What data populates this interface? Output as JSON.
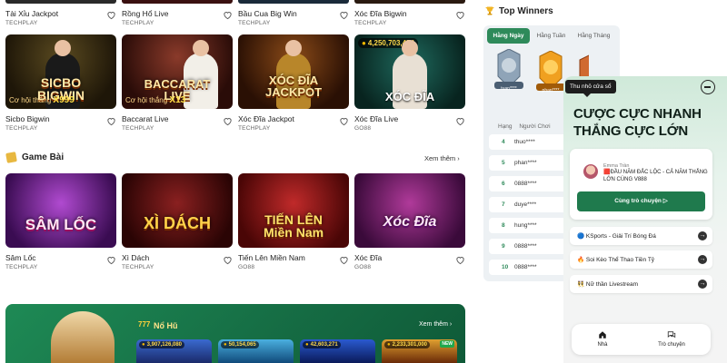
{
  "top_row": [
    {
      "name": "Tài Xỉu Jackpot",
      "provider": "TECHPLAY"
    },
    {
      "name": "Rồng Hổ Live",
      "provider": "TECHPLAY"
    },
    {
      "name": "Bầu Cua Big Win",
      "provider": "TECHPLAY"
    },
    {
      "name": "Xóc Đĩa Bigwin",
      "provider": "TECHPLAY"
    }
  ],
  "live_row": [
    {
      "name": "Sicbo Bigwin",
      "provider": "TECHPLAY",
      "art_title": "SICBO\nBIGWIN",
      "art_sub": "Cơ hội thắng",
      "art_mult": "X999",
      "accent": "#3a2a10"
    },
    {
      "name": "Baccarat Live",
      "provider": "TECHPLAY",
      "art_title": "BACCARAT\nLIVE",
      "art_sub": "Cơ hội thắng",
      "art_mult": "X13",
      "accent": "#5a1818"
    },
    {
      "name": "Xóc Đĩa Jackpot",
      "provider": "TECHPLAY",
      "art_title": "XÓC ĐĨA\nJACKPOT",
      "accent": "#3b1a08"
    },
    {
      "name": "Xóc Đĩa Live",
      "provider": "GO88",
      "art_title": "XÓC ĐĨA",
      "jackpot": "4,250,703,454",
      "accent": "#0f3f3a"
    }
  ],
  "game_bai": {
    "title": "Game Bài",
    "see_more": "Xem thêm",
    "items": [
      {
        "name": "Sâm Lốc",
        "provider": "TECHPLAY",
        "art_title": "SÂM LỐC",
        "accent": "#6a1d8a"
      },
      {
        "name": "Xì Dách",
        "provider": "TECHPLAY",
        "art_title": "XÌ DÁCH",
        "accent": "#4a1010"
      },
      {
        "name": "Tiến Lên Miền Nam",
        "provider": "GO88",
        "art_title": "TIẾN LÊN\nMiền Nam",
        "accent": "#7a1418"
      },
      {
        "name": "Xóc Đĩa",
        "provider": "GO88",
        "art_title": "Xóc Đĩa",
        "accent": "#5a1860"
      }
    ]
  },
  "winners": {
    "title": "Top Winners",
    "tabs": [
      "Hằng Ngày",
      "Hằng Tuần",
      "Hằng Tháng"
    ],
    "podium_names": [
      "tuan****",
      "phan****",
      ""
    ],
    "col_rank": "Hạng",
    "col_player": "Người Chơi",
    "rows": [
      {
        "rank": "4",
        "name": "thuo****"
      },
      {
        "rank": "5",
        "name": "phan****"
      },
      {
        "rank": "6",
        "name": "0888****"
      },
      {
        "rank": "7",
        "name": "duye****"
      },
      {
        "rank": "8",
        "name": "hung****"
      },
      {
        "rank": "9",
        "name": "0888****"
      },
      {
        "rank": "10",
        "name": "0888****"
      }
    ]
  },
  "popup": {
    "tooltip": "Thu nhỏ cửa sổ",
    "headline": "CƯỢC CỰC NHANH\nTHẮNG CỰC LỚN",
    "ad_author": "Emma Trần",
    "ad_text": "🟥ĐẦU NĂM ĐẮC LỘC - CẢ NĂM THẮNG LỚN CÙNG V888",
    "cta": "Cùng trò chuyện ▷",
    "links": [
      "🔵 KSports - Giải Trí Bóng Đá",
      "🔥 Soi Kèo Thể Thao Tiền Tỷ",
      "👯 Nữ thần Livestream"
    ],
    "nav_home": "Nhà",
    "nav_chat": "Trò chuyện"
  },
  "nohu": {
    "title": "Nổ Hũ",
    "icon_text": "777",
    "see_more": "Xem thêm",
    "jackpots": [
      "3,907,126,080",
      "50,154,065",
      "42,603,271",
      "2,233,301,000"
    ],
    "new_badge": "NEW"
  },
  "colors": {
    "brand_green": "#1f7a4d",
    "tab_active": "#2e8a5a"
  }
}
